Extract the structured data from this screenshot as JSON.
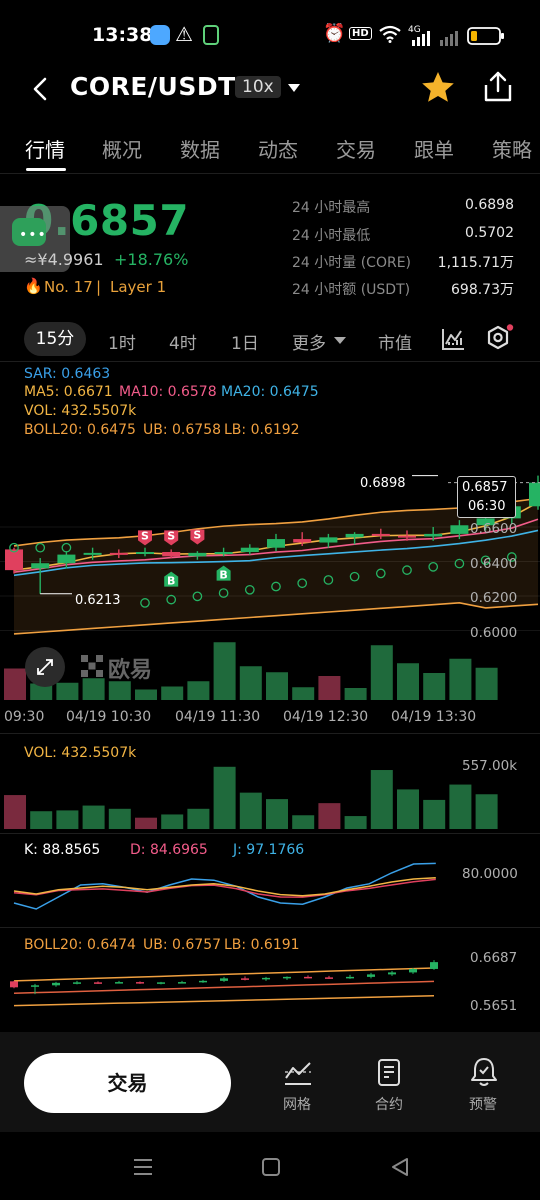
{
  "status": {
    "time": "13:38",
    "hd": "HD",
    "net": "4G"
  },
  "header": {
    "title": "CORE/USDT",
    "leverage": "10x"
  },
  "tabs": [
    "行情",
    "概况",
    "数据",
    "动态",
    "交易",
    "跟单",
    "策略"
  ],
  "ticker": {
    "price": "0.6857",
    "cny": "≈¥4.9961",
    "change": "+18.76%",
    "rank": "No. 17",
    "layer": "Layer 1",
    "stats": [
      {
        "label": "24 小时最高",
        "value": "0.6898"
      },
      {
        "label": "24 小时最低",
        "value": "0.5702"
      },
      {
        "label": "24 小时量 (CORE)",
        "value": "1,115.71万"
      },
      {
        "label": "24 小时额 (USDT)",
        "value": "698.73万"
      }
    ]
  },
  "intervals": {
    "active": "15分",
    "items": [
      "1时",
      "4时",
      "1日"
    ],
    "more": "更多",
    "mcap": "市值"
  },
  "indicators": {
    "sar": "SAR: 0.6463",
    "ma5": "MA5: 0.6671",
    "ma10": "MA10: 0.6578",
    "ma20": "MA20: 0.6475",
    "vol": "VOL: 432.5507k",
    "boll": "BOLL20: 0.6475",
    "ub": "UB: 0.6758",
    "lb": "LB: 0.6192"
  },
  "main_chart": {
    "y_ticks": [
      "0.6600",
      "0.6400",
      "0.6200",
      "0.6000"
    ],
    "high_label": "0.6898",
    "low_label": "0.6213",
    "last_price": "0.6857",
    "countdown": "06:30",
    "watermark": "欧易",
    "x_ticks": [
      "09:30",
      "04/19 10:30",
      "04/19 11:30",
      "04/19 12:30",
      "04/19 13:30"
    ],
    "sell_marker": "S",
    "buy_marker": "B"
  },
  "vol_panel": {
    "label": "VOL: 432.5507k",
    "y_tick": "557.00k"
  },
  "kdj_panel": {
    "k": "K: 88.8565",
    "d": "D: 84.6965",
    "j": "J: 97.1766",
    "y_tick": "80.0000"
  },
  "boll_panel": {
    "boll": "BOLL20: 0.6474",
    "ub": "UB: 0.6757",
    "lb": "LB: 0.6191",
    "y_ticks": [
      "0.6687",
      "0.5651"
    ]
  },
  "bottom": {
    "trade": "交易",
    "grid": "网格",
    "contract": "合约",
    "alert": "预警"
  },
  "colors": {
    "up": "#25b363",
    "down": "#e0405e",
    "sar": "#3aa0e8",
    "ma5": "#f2b544",
    "ma10": "#f25c8a",
    "ma20": "#3fb3e6",
    "boll": "#f0a040"
  },
  "chart_data": {
    "type": "candlestick",
    "interval": "15分",
    "candles_ohlc": [
      [
        0.647,
        0.648,
        0.633,
        0.635
      ],
      [
        0.636,
        0.642,
        0.6213,
        0.639
      ],
      [
        0.639,
        0.646,
        0.636,
        0.644
      ],
      [
        0.644,
        0.648,
        0.641,
        0.645
      ],
      [
        0.645,
        0.647,
        0.642,
        0.6445
      ],
      [
        0.6445,
        0.648,
        0.643,
        0.6455
      ],
      [
        0.6455,
        0.647,
        0.642,
        0.643
      ],
      [
        0.643,
        0.646,
        0.641,
        0.645
      ],
      [
        0.645,
        0.648,
        0.643,
        0.6455
      ],
      [
        0.6455,
        0.65,
        0.644,
        0.648
      ],
      [
        0.648,
        0.656,
        0.646,
        0.653
      ],
      [
        0.653,
        0.657,
        0.649,
        0.651
      ],
      [
        0.651,
        0.656,
        0.648,
        0.654
      ],
      [
        0.654,
        0.657,
        0.65,
        0.656
      ],
      [
        0.656,
        0.659,
        0.653,
        0.655
      ],
      [
        0.655,
        0.658,
        0.652,
        0.6545
      ],
      [
        0.6545,
        0.66,
        0.652,
        0.656
      ],
      [
        0.656,
        0.664,
        0.653,
        0.661
      ],
      [
        0.661,
        0.668,
        0.658,
        0.665
      ],
      [
        0.665,
        0.674,
        0.662,
        0.672
      ],
      [
        0.672,
        0.6898,
        0.67,
        0.6857
      ]
    ],
    "volume": [
      210,
      110,
      115,
      145,
      125,
      70,
      90,
      125,
      385,
      225,
      185,
      85,
      160,
      80,
      365,
      245,
      180,
      275,
      215
    ],
    "y_range": [
      0.595,
      0.695
    ]
  }
}
